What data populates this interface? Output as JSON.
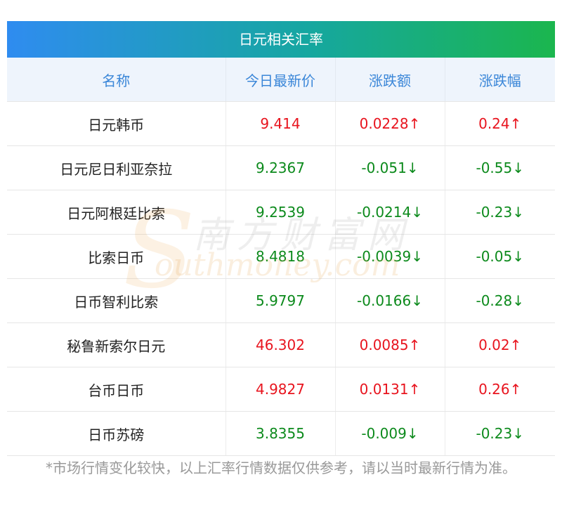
{
  "title": "日元相关汇率",
  "headers": [
    "名称",
    "今日最新价",
    "涨跌额",
    "涨跌幅"
  ],
  "rows": [
    {
      "name": "日元韩币",
      "price": "9.414",
      "change": "0.0228↑",
      "pct": "0.24↑",
      "dir": "up"
    },
    {
      "name": "日元尼日利亚奈拉",
      "price": "9.2367",
      "change": "-0.051↓",
      "pct": "-0.55↓",
      "dir": "down"
    },
    {
      "name": "日元阿根廷比索",
      "price": "9.2539",
      "change": "-0.0214↓",
      "pct": "-0.23↓",
      "dir": "down"
    },
    {
      "name": "比索日币",
      "price": "8.4818",
      "change": "-0.0039↓",
      "pct": "-0.05↓",
      "dir": "down"
    },
    {
      "name": "日币智利比索",
      "price": "5.9797",
      "change": "-0.0166↓",
      "pct": "-0.28↓",
      "dir": "down"
    },
    {
      "name": "秘鲁新索尔日元",
      "price": "46.302",
      "change": "0.0085↑",
      "pct": "0.02↑",
      "dir": "up"
    },
    {
      "name": "台币日币",
      "price": "4.9827",
      "change": "0.0131↑",
      "pct": "0.26↑",
      "dir": "up"
    },
    {
      "name": "日币苏磅",
      "price": "3.8355",
      "change": "-0.009↓",
      "pct": "-0.23↓",
      "dir": "down"
    }
  ],
  "footnote": "*市场行情变化较快，以上汇率行情数据仅供参考，请以当时最新行情为准。",
  "watermark": {
    "cn": "南方财富网",
    "en": "outhmoney.com",
    "s": "S"
  },
  "colors": {
    "up": "#e8141e",
    "down": "#0c8a1c",
    "header_text": "#3a86d8"
  }
}
